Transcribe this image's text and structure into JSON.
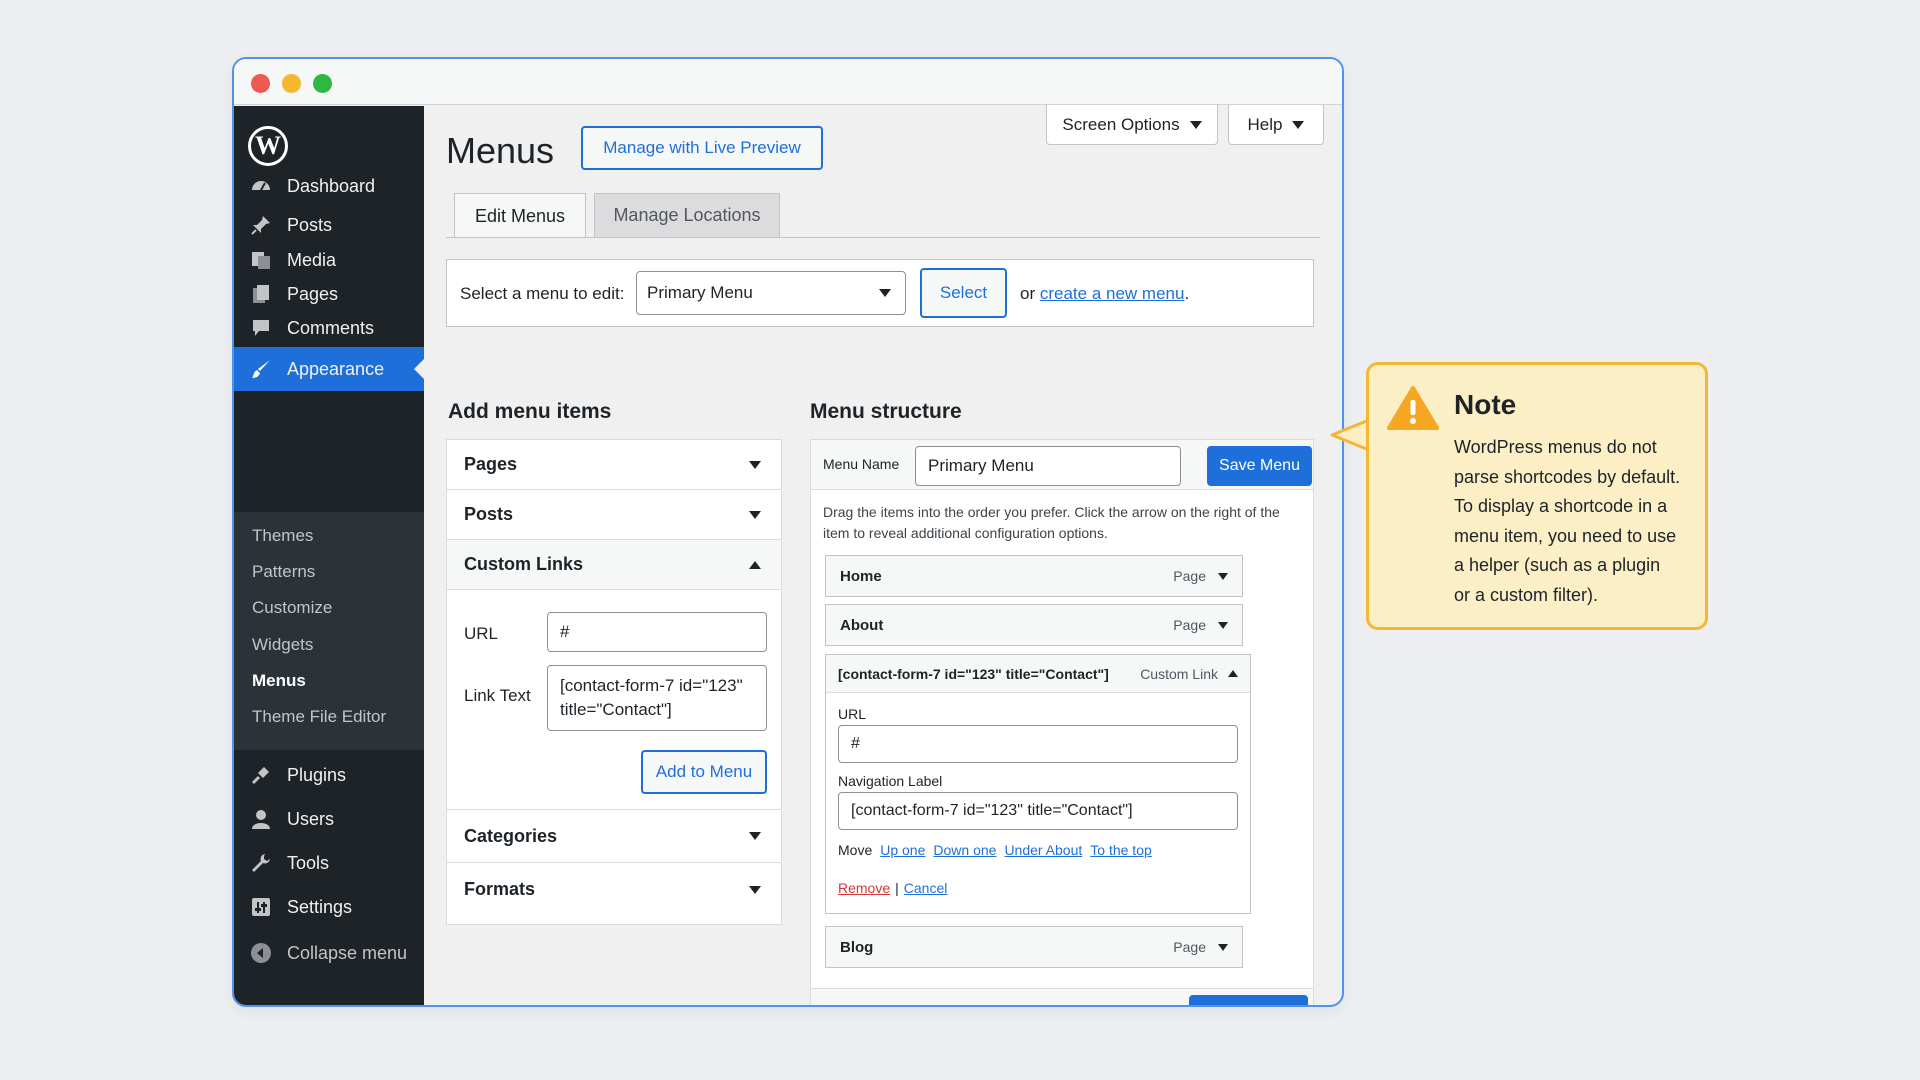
{
  "sidebar": {
    "items": [
      {
        "label": "Dashboard",
        "icon": "dashboard-icon"
      },
      {
        "label": "Posts",
        "icon": "pin-icon"
      },
      {
        "label": "Media",
        "icon": "media-icon"
      },
      {
        "label": "Pages",
        "icon": "pages-icon"
      },
      {
        "label": "Comments",
        "icon": "comment-icon"
      },
      {
        "label": "Appearance",
        "icon": "brush-icon"
      },
      {
        "label": "Plugins",
        "icon": "plug-icon"
      },
      {
        "label": "Users",
        "icon": "user-icon"
      },
      {
        "label": "Tools",
        "icon": "wrench-icon"
      },
      {
        "label": "Settings",
        "icon": "settings-icon"
      }
    ],
    "submenu": [
      "Themes",
      "Patterns",
      "Customize",
      "Widgets",
      "Menus",
      "Theme File Editor"
    ],
    "collapse_label": "Collapse menu"
  },
  "header": {
    "title": "Menus",
    "live_preview": "Manage with Live Preview",
    "screen_options": "Screen Options",
    "help": "Help"
  },
  "tabs": [
    "Edit Menus",
    "Manage Locations"
  ],
  "select_bar": {
    "label": "Select a menu to edit:",
    "selected": "Primary Menu",
    "select_button": "Select",
    "or_text": "or",
    "create_link": "create a new menu",
    "period": "."
  },
  "add_items": {
    "heading": "Add menu items",
    "pages": "Pages",
    "posts": "Posts",
    "custom_links": "Custom Links",
    "url_label": "URL",
    "url_value": "#",
    "link_text_label": "Link Text",
    "link_text_line1": "[contact-form-7 id=\"123\"",
    "link_text_line2": "title=\"Contact\"]",
    "add_button": "Add to Menu",
    "categories": "Categories",
    "formats": "Formats"
  },
  "structure": {
    "heading": "Menu structure",
    "name_label": "Menu Name",
    "name_value": "Primary Menu",
    "save_label": "Save Menu",
    "instructions_line1": "Drag the items into the order you prefer. Click the arrow on the right of the",
    "instructions_line2": "item to reveal additional configuration options.",
    "items": [
      {
        "title": "Home",
        "type": "Page"
      },
      {
        "title": "About",
        "type": "Page"
      },
      {
        "title": "Blog",
        "type": "Page"
      }
    ],
    "expanded": {
      "title": "[contact-form-7 id=\"123\" title=\"Contact\"]",
      "type": "Custom Link",
      "url_label": "URL",
      "url_value": "#",
      "nav_label": "Navigation Label",
      "nav_value": "[contact-form-7 id=\"123\" title=\"Contact\"]",
      "move_label": "Move",
      "move_links": [
        "Up one",
        "Down one",
        "Under About",
        "To the top"
      ],
      "remove": "Remove",
      "separator": "|",
      "cancel": "Cancel"
    }
  },
  "note": {
    "title": "Note",
    "body": "WordPress menus do not\nparse shortcodes by default.\nTo display a shortcode in a\nmenu item, you need to use\na helper (such as a plugin\nor a custom filter)."
  },
  "colors": {
    "accent": "#1e6fd9",
    "sidebar": "#1d2327",
    "note_bg": "#fcefc6",
    "note_border": "#f5b633",
    "remove": "#d63638"
  }
}
